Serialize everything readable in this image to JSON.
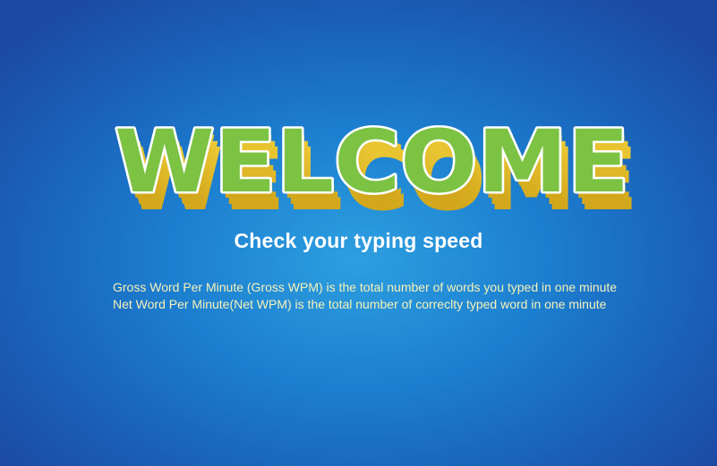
{
  "welcome": {
    "text": "WELCOME",
    "fill_color": "#7cc243",
    "outline_color": "#ffffff",
    "extrude_color": "#e5b820"
  },
  "subtitle": "Check your typing speed",
  "descriptions": [
    "Gross Word Per Minute (Gross WPM) is  the total number of words you typed in one minute",
    "Net Word Per Minute(Net WPM) is the total number of correclty typed word in one minute"
  ],
  "colors": {
    "background": "#1f7fd0",
    "description_text": "#f5f1b8",
    "subtitle_text": "#ffffff"
  }
}
